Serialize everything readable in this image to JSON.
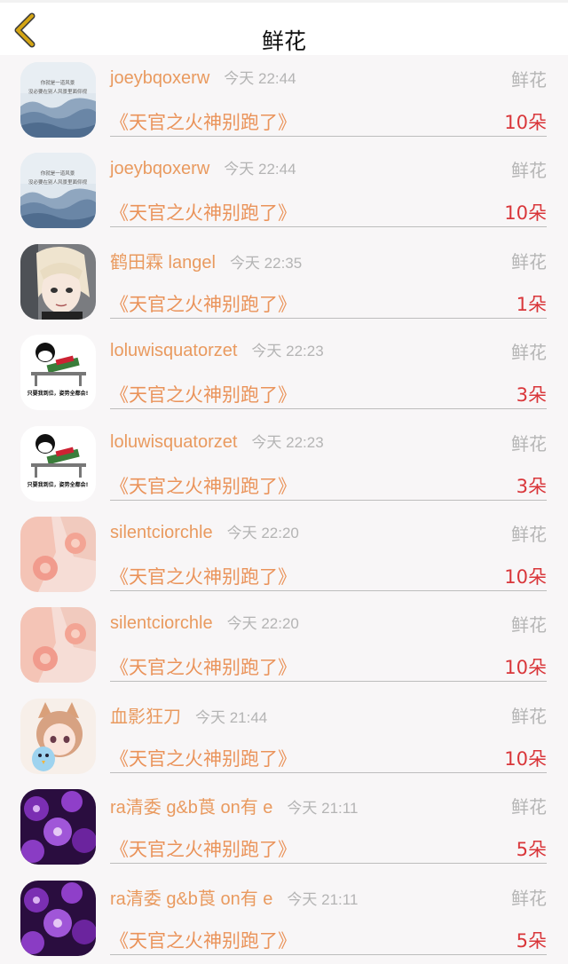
{
  "header": {
    "title": "鲜花",
    "back_icon": "chevron-left-icon",
    "accent": "#d4a514"
  },
  "list": {
    "items": [
      {
        "name": "joeybqoxerw",
        "time": "今天 22:44",
        "gift": "鲜花",
        "book": "《天官之火神别跑了》",
        "count": "10朵",
        "avatar": "clouds"
      },
      {
        "name": "joeybqoxerw",
        "time": "今天 22:44",
        "gift": "鲜花",
        "book": "《天官之火神别跑了》",
        "count": "10朵",
        "avatar": "clouds"
      },
      {
        "name": "鹤田霖 langel",
        "time": "今天 22:35",
        "gift": "鲜花",
        "book": "《天官之火神别跑了》",
        "count": "1朵",
        "avatar": "anime-boy"
      },
      {
        "name": "loluwisquatorzet",
        "time": "今天 22:23",
        "gift": "鲜花",
        "book": "《天官之火神别跑了》",
        "count": "3朵",
        "avatar": "cartoon-desk"
      },
      {
        "name": "loluwisquatorzet",
        "time": "今天 22:23",
        "gift": "鲜花",
        "book": "《天官之火神别跑了》",
        "count": "3朵",
        "avatar": "cartoon-desk"
      },
      {
        "name": "silentciorchle",
        "time": "今天 22:20",
        "gift": "鲜花",
        "book": "《天官之火神别跑了》",
        "count": "10朵",
        "avatar": "pink-flowers"
      },
      {
        "name": "silentciorchle",
        "time": "今天 22:20",
        "gift": "鲜花",
        "book": "《天官之火神别跑了》",
        "count": "10朵",
        "avatar": "pink-flowers"
      },
      {
        "name": "血影狂刀",
        "time": "今天 21:44",
        "gift": "鲜花",
        "book": "《天官之火神别跑了》",
        "count": "10朵",
        "avatar": "anime-girl"
      },
      {
        "name": "ra清委 g&b莨 on有 e",
        "time": "今天 21:11",
        "gift": "鲜花",
        "book": "《天官之火神别跑了》",
        "count": "5朵",
        "avatar": "purple-flowers"
      },
      {
        "name": "ra清委 g&b莨 on有 e",
        "time": "今天 21:11",
        "gift": "鲜花",
        "book": "《天官之火神别跑了》",
        "count": "5朵",
        "avatar": "purple-flowers"
      }
    ],
    "avatar_captions": {
      "clouds": [
        "你就是一道风景",
        "没必要在别人风景里面仰视"
      ],
      "cartoon-desk": [
        "只要我到位，姿势全都会!"
      ]
    }
  }
}
